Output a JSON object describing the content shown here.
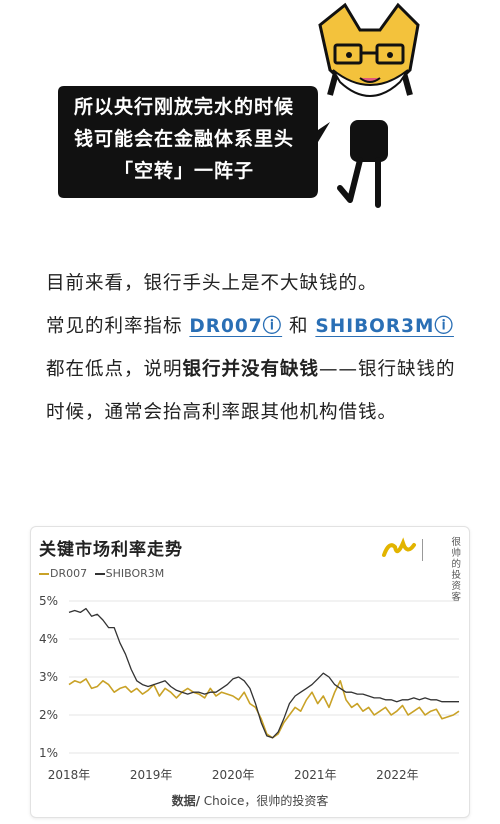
{
  "comic": {
    "speech_lines": [
      "所以央行刚放完水的时候",
      "钱可能会在金融体系里头",
      "「空转」一阵子"
    ]
  },
  "article": {
    "p1": "目前来看，银行手头上是不大缺钱的。",
    "p2_prefix": "常见的利率指标 ",
    "link1": "DR007ⓘ",
    "p2_mid": " 和 ",
    "link2": "SHIBOR3Mⓘ",
    "p2_after": " 都在低点，说明",
    "p2_bold": "银行并没有缺钱",
    "p2_suffix": "——银行缺钱的时候，通常会抬高利率跟其他机构借钱。"
  },
  "chart_card": {
    "brand_line1": "很帅的",
    "brand_line2": "投资客",
    "source_bold": "数据/",
    "source_rest": " Choice，很帅的投资客"
  },
  "chart_data": {
    "type": "line",
    "title": "关键市场利率走势",
    "series": [
      {
        "name": "DR007",
        "color": "#c9a227",
        "values": [
          2.8,
          2.9,
          2.85,
          2.95,
          2.7,
          2.75,
          2.9,
          2.8,
          2.6,
          2.7,
          2.75,
          2.6,
          2.7,
          2.55,
          2.65,
          2.8,
          2.5,
          2.7,
          2.6,
          2.45,
          2.6,
          2.7,
          2.6,
          2.55,
          2.45,
          2.7,
          2.5,
          2.6,
          2.55,
          2.5,
          2.4,
          2.6,
          2.3,
          2.2,
          1.9,
          1.5,
          1.4,
          1.5,
          1.8,
          2.0,
          2.2,
          2.1,
          2.4,
          2.6,
          2.3,
          2.5,
          2.2,
          2.6,
          2.9,
          2.4,
          2.2,
          2.3,
          2.1,
          2.2,
          2.0,
          2.1,
          2.2,
          2.0,
          2.1,
          2.25,
          2.0,
          2.1,
          2.2,
          2.0,
          2.1,
          2.15,
          1.9,
          1.95,
          2.0,
          2.1
        ]
      },
      {
        "name": "SHIBOR3M",
        "color": "#333333",
        "values": [
          4.7,
          4.75,
          4.7,
          4.8,
          4.6,
          4.65,
          4.5,
          4.3,
          4.3,
          3.9,
          3.6,
          3.2,
          2.9,
          2.8,
          2.75,
          2.8,
          2.85,
          2.9,
          2.75,
          2.65,
          2.6,
          2.55,
          2.6,
          2.6,
          2.55,
          2.6,
          2.6,
          2.7,
          2.8,
          2.95,
          3.0,
          2.9,
          2.7,
          2.3,
          1.8,
          1.45,
          1.4,
          1.55,
          1.9,
          2.3,
          2.5,
          2.6,
          2.7,
          2.8,
          2.95,
          3.1,
          3.0,
          2.8,
          2.7,
          2.6,
          2.6,
          2.55,
          2.55,
          2.5,
          2.45,
          2.45,
          2.4,
          2.4,
          2.35,
          2.4,
          2.4,
          2.45,
          2.4,
          2.45,
          2.4,
          2.4,
          2.35,
          2.35,
          2.35,
          2.35
        ]
      }
    ],
    "x_range": [
      2018.0,
      2022.75
    ],
    "x_ticks": [
      "2018年",
      "2019年",
      "2020年",
      "2021年",
      "2022年"
    ],
    "y_range": [
      1,
      5
    ],
    "y_ticks": [
      "1%",
      "2%",
      "3%",
      "4%",
      "5%"
    ],
    "grid": true,
    "legend_position": "top-left"
  }
}
